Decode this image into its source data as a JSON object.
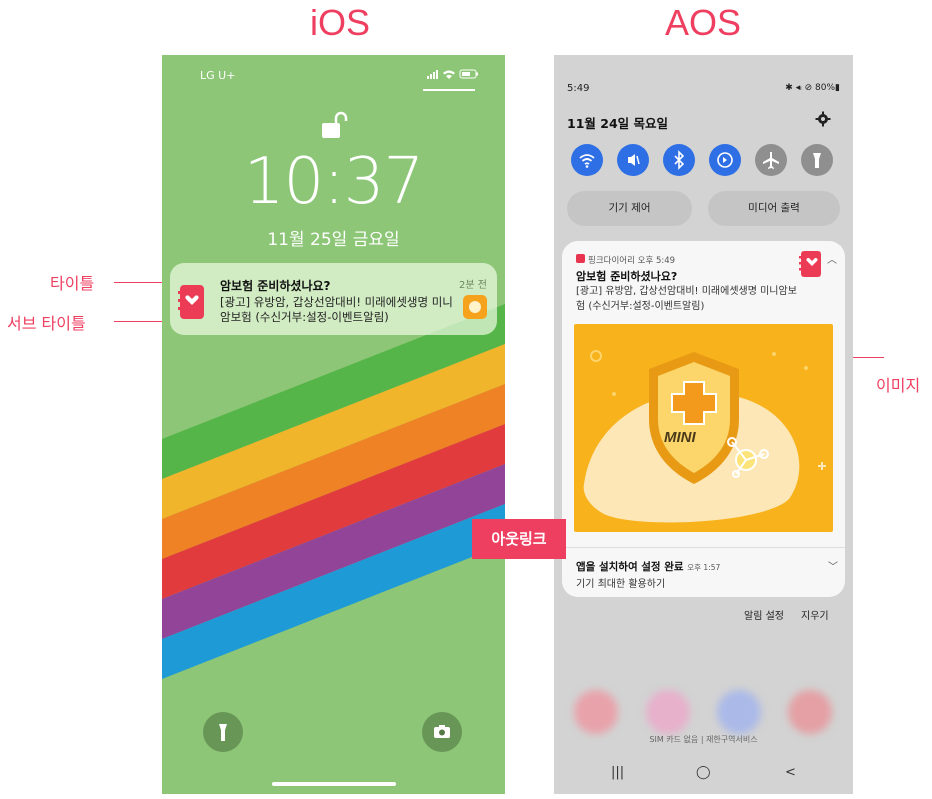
{
  "headings": {
    "ios": "iOS",
    "aos": "AOS"
  },
  "callouts": {
    "title": "타이틀",
    "subtitle": "서브 타이틀",
    "image": "이미지",
    "outlink": "아웃링크"
  },
  "ios": {
    "carrier": "LG U+",
    "status_icons": "signal-icon wifi-icon battery-icon",
    "time": "10:37",
    "date": "11월 25일 금요일",
    "notification": {
      "title": "암보험 준비하셨나요?",
      "body": "[광고] 유방암, 갑상선암대비! 미래에셋생명 미니암보험 (수신거부:설정-이벤트알림)",
      "time": "2분 전"
    },
    "icons": [
      "lock-open-icon",
      "flashlight-icon",
      "camera-icon"
    ]
  },
  "aos": {
    "status_time": "5:49",
    "status_right": "✱ ◂ᵢ ⊘ 80%▮",
    "date": "11월 24일 목요일",
    "quick_settings": [
      "wifi-icon",
      "mute-icon",
      "bluetooth-icon",
      "rotate-icon",
      "airplane-icon",
      "flashlight-icon"
    ],
    "pills": {
      "device": "기기 제어",
      "media": "미디어 출력"
    },
    "card": {
      "app": "핑크다이어리 오후 5:49",
      "title": "암보험 준비하셨나요?",
      "body": "[광고] 유방암, 갑상선암대비! 미래에셋생명 미니암보험 (수신거부:설정-이벤트알림)",
      "image_text": "MINI"
    },
    "card2": {
      "title": "앱을 설치하여 설정 완료",
      "time": "오후 1:57",
      "sub": "기기 최대한 활용하기"
    },
    "links": {
      "settings": "알림 설정",
      "clear": "지우기"
    },
    "sim": "SIM 카드 없음 | 재한구역서비스",
    "nav": {
      "recent": "|||",
      "home": "◯",
      "back": "<"
    }
  },
  "colors": {
    "accent": "#ef3f60",
    "ios_bg": "#8cc676",
    "android_blue": "#2e6fe6",
    "image_yellow": "#f8b21c"
  }
}
